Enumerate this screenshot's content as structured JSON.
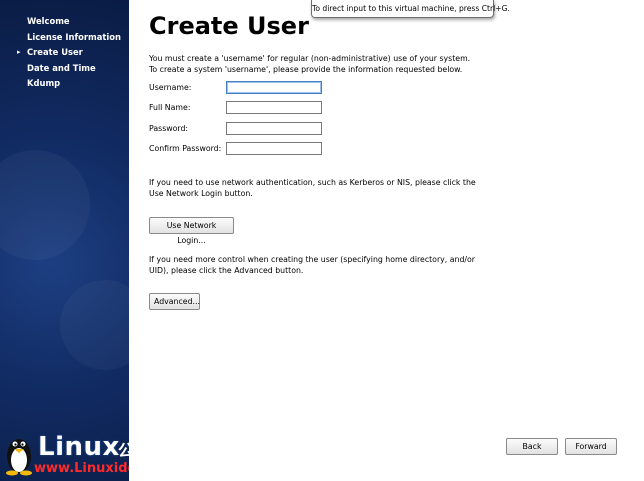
{
  "sidebar": {
    "steps": [
      {
        "label": "Welcome",
        "current": false
      },
      {
        "label": "License Information",
        "current": false
      },
      {
        "label": "Create User",
        "current": true
      },
      {
        "label": "Date and Time",
        "current": false
      },
      {
        "label": "Kdump",
        "current": false
      }
    ],
    "current_marker": "▸"
  },
  "tooltip": "To direct input to this virtual machine, press Ctrl+G.",
  "page": {
    "title": "Create User",
    "intro_line1": "You must create a 'username' for regular (non-administrative) use of your system.",
    "intro_line2": "To create a system 'username', please provide the information requested below."
  },
  "form": {
    "username_label": "Username:",
    "username_value": "",
    "fullname_label": "Full Name:",
    "fullname_value": "",
    "password_label": "Password:",
    "password_value": "",
    "confirm_label": "Confirm Password:",
    "confirm_value": ""
  },
  "network": {
    "text_line1": "If you need to use network authentication, such as Kerberos or NIS, please click the",
    "text_line2": "Use Network Login button.",
    "button": "Use Network Login..."
  },
  "advanced": {
    "text_line1": "If you need more control when creating the user (specifying home directory, and/or",
    "text_line2": "UID), please click the Advanced button.",
    "button": "Advanced..."
  },
  "nav": {
    "back": "Back",
    "forward": "Forward"
  },
  "watermark": {
    "word": "Linux",
    "cn": "公社",
    "url": "www.Linuxidc.com"
  }
}
